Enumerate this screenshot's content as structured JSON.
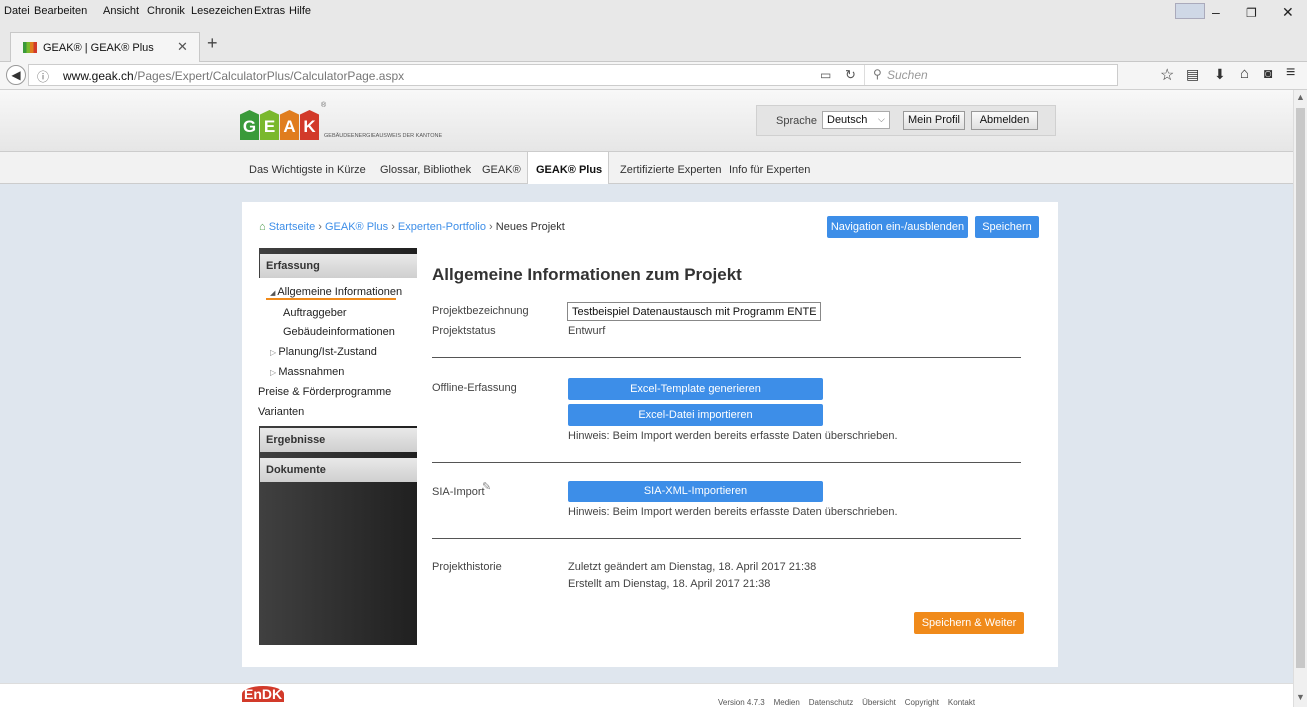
{
  "browser": {
    "menu": [
      "Datei",
      "Bearbeiten",
      "Ansicht",
      "Chronik",
      "Lesezeichen",
      "Extras",
      "Hilfe"
    ],
    "tab_title": "GEAK® | GEAK® Plus",
    "url_host": "www.geak.ch",
    "url_path": "/Pages/Expert/CalculatorPlus/CalculatorPage.aspx",
    "search_placeholder": "Suchen"
  },
  "header": {
    "logo_letters": [
      "G",
      "E",
      "A",
      "K"
    ],
    "logo_colors": [
      "#3a9a3a",
      "#7ab82d",
      "#e07d1e",
      "#d23a2a"
    ],
    "logo_tagline": "GEBÄUDEENERGIEAUSWEIS DER KANTONE",
    "language_label": "Sprache",
    "language_value": "Deutsch",
    "profile_button": "Mein Profil",
    "logout_button": "Abmelden"
  },
  "nav": [
    "Das Wichtigste in Kürze",
    "Glossar, Bibliothek",
    "GEAK®",
    "GEAK® Plus",
    "Zertifizierte Experten",
    "Info für Experten"
  ],
  "breadcrumb": [
    "Startseite",
    "GEAK® Plus",
    "Experten-Portfolio",
    "Neues Projekt"
  ],
  "toolbar": {
    "toggle_nav": "Navigation ein-/ausblenden",
    "save": "Speichern"
  },
  "sidebar": {
    "erfassung": "Erfassung",
    "items": [
      "Allgemeine Informationen",
      "Auftraggeber",
      "Gebäudeinformationen",
      "Planung/Ist-Zustand",
      "Massnahmen",
      "Preise & Förderprogramme",
      "Varianten"
    ],
    "ergebnisse": "Ergebnisse",
    "dokumente": "Dokumente"
  },
  "main": {
    "title": "Allgemeine Informationen zum Projekt",
    "project_name_label": "Projektbezeichnung",
    "project_name_value": "Testbeispiel Datenaustausch mit Programm ENTECH",
    "status_label": "Projektstatus",
    "status_value": "Entwurf",
    "offline_label": "Offline-Erfassung",
    "excel_template_btn": "Excel-Template generieren",
    "excel_import_btn": "Excel-Datei importieren",
    "hint": "Hinweis: Beim Import werden bereits erfasste Daten überschrieben.",
    "sia_label": "SIA-Import",
    "sia_btn": "SIA-XML-Importieren",
    "history_label": "Projekthistorie",
    "history_changed": "Zuletzt geändert am Dienstag, 18. April 2017 21:38",
    "history_created": "Erstellt am Dienstag, 18. April 2017 21:38",
    "save_next": "Speichern & Weiter"
  },
  "footer": {
    "logo": "EnDK",
    "links": [
      "Version 4.7.3",
      "Medien",
      "Datenschutz",
      "Übersicht",
      "Copyright",
      "Kontakt"
    ]
  }
}
